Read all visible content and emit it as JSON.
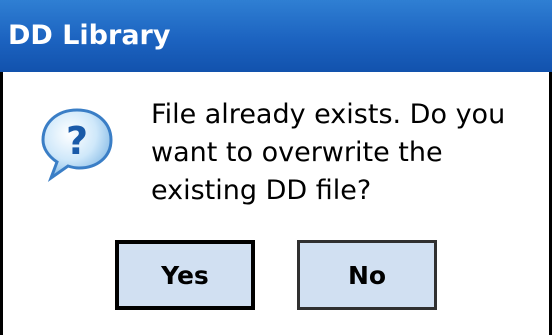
{
  "window": {
    "title": "DD Library"
  },
  "dialog": {
    "icon": "question-icon",
    "message": "File already exists. Do you\nwant to overwrite the\nexisting DD file?",
    "buttons": {
      "yes_label": "Yes",
      "no_label": "No"
    }
  },
  "colors": {
    "titlebar": "#1c63c0",
    "title_text": "#ffffff",
    "button_fill": "#d1e0f2",
    "icon_fill": "#bfe0f7",
    "icon_glyph": "#1a5aa8"
  }
}
